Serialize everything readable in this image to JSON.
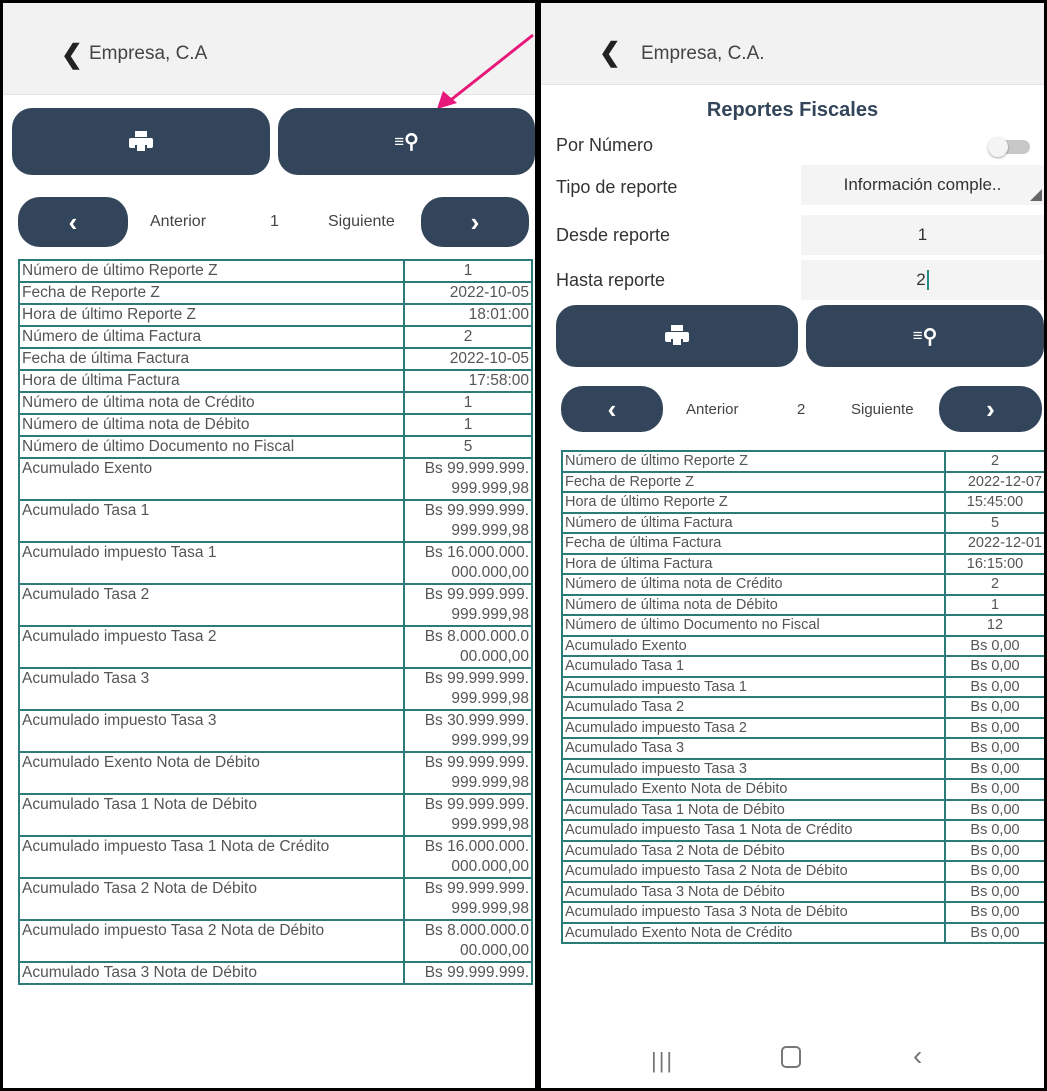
{
  "left": {
    "appbar": {
      "title": "Empresa, C.A"
    },
    "pager": {
      "prev_label": "Anterior",
      "page": "1",
      "next_label": "Siguiente"
    },
    "rows": [
      {
        "label": "Número de último Reporte Z",
        "value": "1",
        "align": "c"
      },
      {
        "label": "Fecha de Reporte Z",
        "value": "2022-10-05",
        "align": "v"
      },
      {
        "label": "Hora de último Reporte Z",
        "value": "18:01:00",
        "align": "v"
      },
      {
        "label": "Número de última Factura",
        "value": "2",
        "align": "c"
      },
      {
        "label": "Fecha de última Factura",
        "value": "2022-10-05",
        "align": "v"
      },
      {
        "label": "Hora de última Factura",
        "value": "17:58:00",
        "align": "v"
      },
      {
        "label": "Número de última nota de Crédito",
        "value": "1",
        "align": "c"
      },
      {
        "label": "Número de última nota de Débito",
        "value": "1",
        "align": "c"
      },
      {
        "label": "Número de último Documento no Fiscal",
        "value": "5",
        "align": "c"
      },
      {
        "label": "Acumulado Exento",
        "value": "Bs 99.999.999.\n999.999,98",
        "align": "v"
      },
      {
        "label": "Acumulado Tasa 1",
        "value": "Bs 99.999.999.\n999.999,98",
        "align": "v"
      },
      {
        "label": "Acumulado impuesto Tasa 1",
        "value": "Bs 16.000.000.\n000.000,00",
        "align": "v"
      },
      {
        "label": "Acumulado Tasa 2",
        "value": "Bs 99.999.999.\n999.999,98",
        "align": "v"
      },
      {
        "label": "Acumulado impuesto Tasa 2",
        "value": "Bs 8.000.000.0\n00.000,00",
        "align": "v"
      },
      {
        "label": "Acumulado Tasa 3",
        "value": "Bs 99.999.999.\n999.999,98",
        "align": "v"
      },
      {
        "label": "Acumulado impuesto Tasa 3",
        "value": "Bs 30.999.999.\n999.999,99",
        "align": "v"
      },
      {
        "label": "Acumulado Exento Nota de Débito",
        "value": "Bs 99.999.999.\n999.999,98",
        "align": "v"
      },
      {
        "label": "Acumulado Tasa 1 Nota de Débito",
        "value": "Bs 99.999.999.\n999.999,98",
        "align": "v"
      },
      {
        "label": "Acumulado impuesto Tasa 1 Nota de Crédito",
        "value": "Bs 16.000.000.\n000.000,00",
        "align": "v"
      },
      {
        "label": "Acumulado Tasa 2 Nota de Débito",
        "value": "Bs 99.999.999.\n999.999,98",
        "align": "v"
      },
      {
        "label": "Acumulado impuesto Tasa 2 Nota de Débito",
        "value": "Bs 8.000.000.0\n00.000,00",
        "align": "v"
      },
      {
        "label": "Acumulado Tasa 3 Nota de Débito",
        "value": "Bs 99.999.999.",
        "align": "v"
      }
    ]
  },
  "right": {
    "appbar": {
      "title": "Empresa, C.A."
    },
    "title": "Reportes Fiscales",
    "form": {
      "por_numero_label": "Por Número",
      "tipo_label": "Tipo de reporte",
      "tipo_value": "Información comple..",
      "desde_label": "Desde reporte",
      "desde_value": "1",
      "hasta_label": "Hasta reporte",
      "hasta_value": "2"
    },
    "pager": {
      "prev_label": "Anterior",
      "page": "2",
      "next_label": "Siguiente"
    },
    "rows": [
      {
        "label": "Número de último Reporte Z",
        "value": "2",
        "align": "c"
      },
      {
        "label": "Fecha de Reporte Z",
        "value": "2022-12-07",
        "align": "v"
      },
      {
        "label": "Hora de último Reporte Z",
        "value": "15:45:00",
        "align": "c"
      },
      {
        "label": "Número de última Factura",
        "value": "5",
        "align": "c"
      },
      {
        "label": "Fecha de última Factura",
        "value": "2022-12-01",
        "align": "v"
      },
      {
        "label": "Hora de última Factura",
        "value": "16:15:00",
        "align": "c"
      },
      {
        "label": "Número de última nota de Crédito",
        "value": "2",
        "align": "c"
      },
      {
        "label": "Número de última nota de Débito",
        "value": "1",
        "align": "c"
      },
      {
        "label": "Número de último Documento no Fiscal",
        "value": "12",
        "align": "c"
      },
      {
        "label": "Acumulado Exento",
        "value": "Bs 0,00",
        "align": "c"
      },
      {
        "label": "Acumulado Tasa 1",
        "value": "Bs 0,00",
        "align": "c"
      },
      {
        "label": "Acumulado impuesto Tasa 1",
        "value": "Bs 0,00",
        "align": "c"
      },
      {
        "label": "Acumulado Tasa 2",
        "value": "Bs 0,00",
        "align": "c"
      },
      {
        "label": "Acumulado impuesto Tasa 2",
        "value": "Bs 0,00",
        "align": "c"
      },
      {
        "label": "Acumulado Tasa 3",
        "value": "Bs 0,00",
        "align": "c"
      },
      {
        "label": "Acumulado impuesto Tasa 3",
        "value": "Bs 0,00",
        "align": "c"
      },
      {
        "label": "Acumulado Exento Nota de Débito",
        "value": "Bs 0,00",
        "align": "c"
      },
      {
        "label": "Acumulado Tasa 1 Nota de Débito",
        "value": "Bs 0,00",
        "align": "c"
      },
      {
        "label": "Acumulado impuesto Tasa 1 Nota de Crédito",
        "value": "Bs 0,00",
        "align": "c"
      },
      {
        "label": "Acumulado Tasa 2 Nota de Débito",
        "value": "Bs 0,00",
        "align": "c"
      },
      {
        "label": "Acumulado impuesto Tasa 2 Nota de Débito",
        "value": "Bs 0,00",
        "align": "c"
      },
      {
        "label": "Acumulado Tasa 3 Nota de Débito",
        "value": "Bs 0,00",
        "align": "c"
      },
      {
        "label": "Acumulado impuesto Tasa 3 Nota de Débito",
        "value": "Bs 0,00",
        "align": "c"
      },
      {
        "label": "Acumulado Exento Nota de Crédito",
        "value": "Bs 0,00",
        "align": "c"
      }
    ]
  },
  "colors": {
    "button_dark": "#33455a",
    "table_border": "#2b7b78",
    "annotation_arrow": "#e8177a"
  },
  "icons": [
    "back-arrow-icon",
    "printer-icon",
    "list-search-icon",
    "chevron-left-icon",
    "chevron-right-icon",
    "toggle-switch",
    "dropdown-triangle-icon",
    "recents-icon",
    "home-icon",
    "back-nav-icon"
  ]
}
